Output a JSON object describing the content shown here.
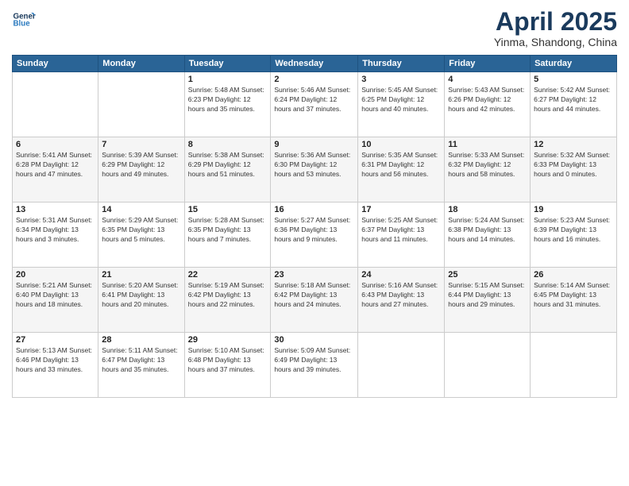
{
  "header": {
    "logo_line1": "General",
    "logo_line2": "Blue",
    "month": "April 2025",
    "location": "Yinma, Shandong, China"
  },
  "days_of_week": [
    "Sunday",
    "Monday",
    "Tuesday",
    "Wednesday",
    "Thursday",
    "Friday",
    "Saturday"
  ],
  "weeks": [
    [
      {
        "day": "",
        "info": ""
      },
      {
        "day": "",
        "info": ""
      },
      {
        "day": "1",
        "info": "Sunrise: 5:48 AM\nSunset: 6:23 PM\nDaylight: 12 hours\nand 35 minutes."
      },
      {
        "day": "2",
        "info": "Sunrise: 5:46 AM\nSunset: 6:24 PM\nDaylight: 12 hours\nand 37 minutes."
      },
      {
        "day": "3",
        "info": "Sunrise: 5:45 AM\nSunset: 6:25 PM\nDaylight: 12 hours\nand 40 minutes."
      },
      {
        "day": "4",
        "info": "Sunrise: 5:43 AM\nSunset: 6:26 PM\nDaylight: 12 hours\nand 42 minutes."
      },
      {
        "day": "5",
        "info": "Sunrise: 5:42 AM\nSunset: 6:27 PM\nDaylight: 12 hours\nand 44 minutes."
      }
    ],
    [
      {
        "day": "6",
        "info": "Sunrise: 5:41 AM\nSunset: 6:28 PM\nDaylight: 12 hours\nand 47 minutes."
      },
      {
        "day": "7",
        "info": "Sunrise: 5:39 AM\nSunset: 6:29 PM\nDaylight: 12 hours\nand 49 minutes."
      },
      {
        "day": "8",
        "info": "Sunrise: 5:38 AM\nSunset: 6:29 PM\nDaylight: 12 hours\nand 51 minutes."
      },
      {
        "day": "9",
        "info": "Sunrise: 5:36 AM\nSunset: 6:30 PM\nDaylight: 12 hours\nand 53 minutes."
      },
      {
        "day": "10",
        "info": "Sunrise: 5:35 AM\nSunset: 6:31 PM\nDaylight: 12 hours\nand 56 minutes."
      },
      {
        "day": "11",
        "info": "Sunrise: 5:33 AM\nSunset: 6:32 PM\nDaylight: 12 hours\nand 58 minutes."
      },
      {
        "day": "12",
        "info": "Sunrise: 5:32 AM\nSunset: 6:33 PM\nDaylight: 13 hours\nand 0 minutes."
      }
    ],
    [
      {
        "day": "13",
        "info": "Sunrise: 5:31 AM\nSunset: 6:34 PM\nDaylight: 13 hours\nand 3 minutes."
      },
      {
        "day": "14",
        "info": "Sunrise: 5:29 AM\nSunset: 6:35 PM\nDaylight: 13 hours\nand 5 minutes."
      },
      {
        "day": "15",
        "info": "Sunrise: 5:28 AM\nSunset: 6:35 PM\nDaylight: 13 hours\nand 7 minutes."
      },
      {
        "day": "16",
        "info": "Sunrise: 5:27 AM\nSunset: 6:36 PM\nDaylight: 13 hours\nand 9 minutes."
      },
      {
        "day": "17",
        "info": "Sunrise: 5:25 AM\nSunset: 6:37 PM\nDaylight: 13 hours\nand 11 minutes."
      },
      {
        "day": "18",
        "info": "Sunrise: 5:24 AM\nSunset: 6:38 PM\nDaylight: 13 hours\nand 14 minutes."
      },
      {
        "day": "19",
        "info": "Sunrise: 5:23 AM\nSunset: 6:39 PM\nDaylight: 13 hours\nand 16 minutes."
      }
    ],
    [
      {
        "day": "20",
        "info": "Sunrise: 5:21 AM\nSunset: 6:40 PM\nDaylight: 13 hours\nand 18 minutes."
      },
      {
        "day": "21",
        "info": "Sunrise: 5:20 AM\nSunset: 6:41 PM\nDaylight: 13 hours\nand 20 minutes."
      },
      {
        "day": "22",
        "info": "Sunrise: 5:19 AM\nSunset: 6:42 PM\nDaylight: 13 hours\nand 22 minutes."
      },
      {
        "day": "23",
        "info": "Sunrise: 5:18 AM\nSunset: 6:42 PM\nDaylight: 13 hours\nand 24 minutes."
      },
      {
        "day": "24",
        "info": "Sunrise: 5:16 AM\nSunset: 6:43 PM\nDaylight: 13 hours\nand 27 minutes."
      },
      {
        "day": "25",
        "info": "Sunrise: 5:15 AM\nSunset: 6:44 PM\nDaylight: 13 hours\nand 29 minutes."
      },
      {
        "day": "26",
        "info": "Sunrise: 5:14 AM\nSunset: 6:45 PM\nDaylight: 13 hours\nand 31 minutes."
      }
    ],
    [
      {
        "day": "27",
        "info": "Sunrise: 5:13 AM\nSunset: 6:46 PM\nDaylight: 13 hours\nand 33 minutes."
      },
      {
        "day": "28",
        "info": "Sunrise: 5:11 AM\nSunset: 6:47 PM\nDaylight: 13 hours\nand 35 minutes."
      },
      {
        "day": "29",
        "info": "Sunrise: 5:10 AM\nSunset: 6:48 PM\nDaylight: 13 hours\nand 37 minutes."
      },
      {
        "day": "30",
        "info": "Sunrise: 5:09 AM\nSunset: 6:49 PM\nDaylight: 13 hours\nand 39 minutes."
      },
      {
        "day": "",
        "info": ""
      },
      {
        "day": "",
        "info": ""
      },
      {
        "day": "",
        "info": ""
      }
    ]
  ]
}
